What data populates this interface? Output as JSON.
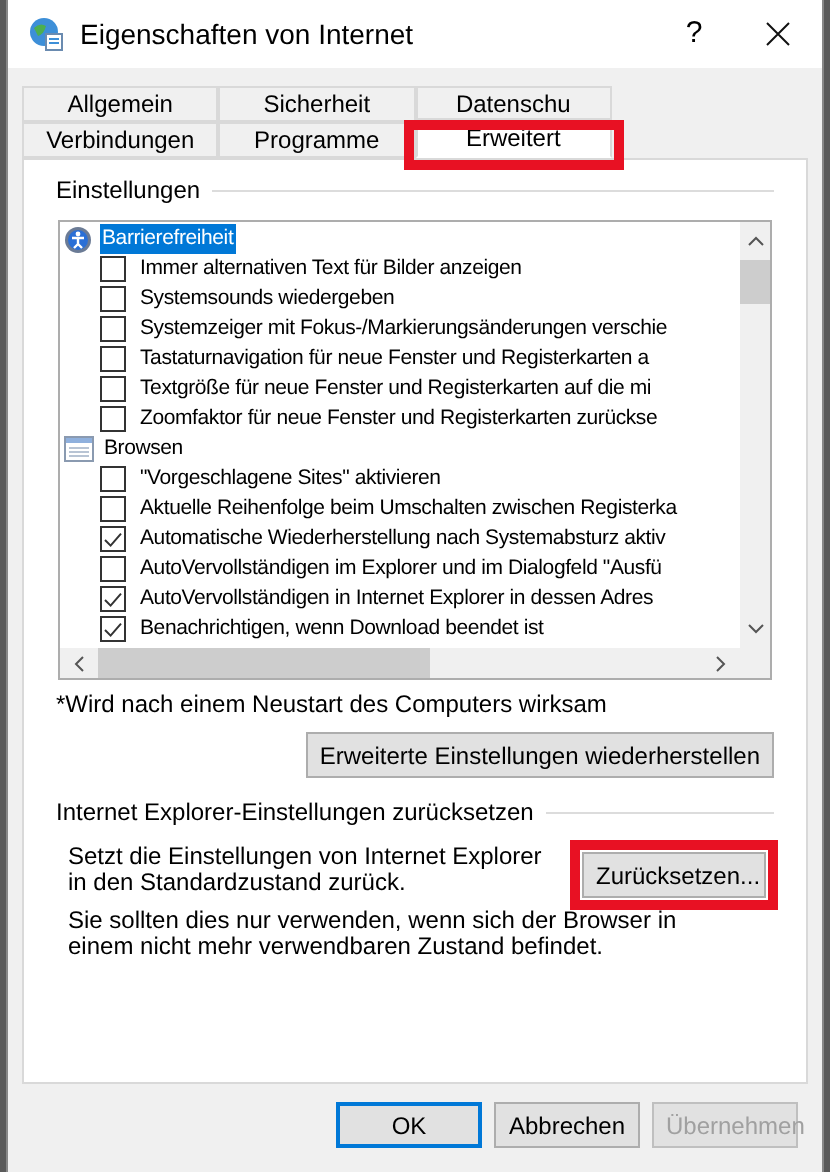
{
  "window": {
    "title": "Eigenschaften von Internet",
    "help": "?"
  },
  "tab_rows": [
    [
      {
        "label": "Allgemein",
        "selected": false
      },
      {
        "label": "Sicherheit",
        "selected": false
      },
      {
        "label": "Datenschu",
        "selected": false
      }
    ],
    [
      {
        "label": "Verbindungen",
        "selected": false
      },
      {
        "label": "Programme",
        "selected": false
      },
      {
        "label": "Erweitert",
        "selected": true,
        "highlighted": true
      }
    ]
  ],
  "settings": {
    "title": "Einstellungen",
    "items": [
      {
        "kind": "category",
        "label": "Barrierefreiheit",
        "selected": true
      },
      {
        "kind": "checkbox",
        "label": "Immer alternativen Text für Bilder anzeigen",
        "checked": false
      },
      {
        "kind": "checkbox",
        "label": "Systemsounds wiedergeben",
        "checked": false
      },
      {
        "kind": "checkbox",
        "label": "Systemzeiger mit Fokus-/Markierungsänderungen verschie",
        "checked": false
      },
      {
        "kind": "checkbox",
        "label": "Tastaturnavigation für neue Fenster und Registerkarten a",
        "checked": false
      },
      {
        "kind": "checkbox",
        "label": "Textgröße für neue Fenster und Registerkarten auf die mi",
        "checked": false
      },
      {
        "kind": "checkbox",
        "label": "Zoomfaktor für neue Fenster und Registerkarten zurückse",
        "checked": false
      },
      {
        "kind": "category",
        "label": "Browsen",
        "selected": false
      },
      {
        "kind": "checkbox",
        "label": "\"Vorgeschlagene Sites\" aktivieren",
        "checked": false
      },
      {
        "kind": "checkbox",
        "label": "Aktuelle Reihenfolge beim Umschalten zwischen Registerka",
        "checked": false
      },
      {
        "kind": "checkbox",
        "label": "Automatische Wiederherstellung nach Systemabsturz aktiv",
        "checked": true
      },
      {
        "kind": "checkbox",
        "label": "AutoVervollständigen im Explorer und im Dialogfeld \"Ausfü",
        "checked": false
      },
      {
        "kind": "checkbox",
        "label": "AutoVervollständigen in Internet Explorer in dessen Adres",
        "checked": true
      },
      {
        "kind": "checkbox",
        "label": "Benachrichtigen, wenn Download beendet ist",
        "checked": true
      }
    ],
    "note": "*Wird nach einem Neustart des Computers wirksam",
    "restore_button": "Erweiterte Einstellungen wiederherstellen"
  },
  "reset": {
    "title": "Internet Explorer-Einstellungen zurücksetzen",
    "description": "Setzt die Einstellungen von Internet Explorer in den Standardzustand zurück.",
    "button": {
      "label": "Zurücksetzen...",
      "highlighted": true
    },
    "warning": "Sie sollten dies nur verwenden, wenn sich der Browser in einem nicht mehr verwendbaren Zustand befindet."
  },
  "buttons": [
    {
      "label": "OK",
      "default": true,
      "disabled": false
    },
    {
      "label": "Abbrechen",
      "default": false,
      "disabled": false
    },
    {
      "label": "Übernehmen",
      "default": false,
      "disabled": true
    }
  ]
}
